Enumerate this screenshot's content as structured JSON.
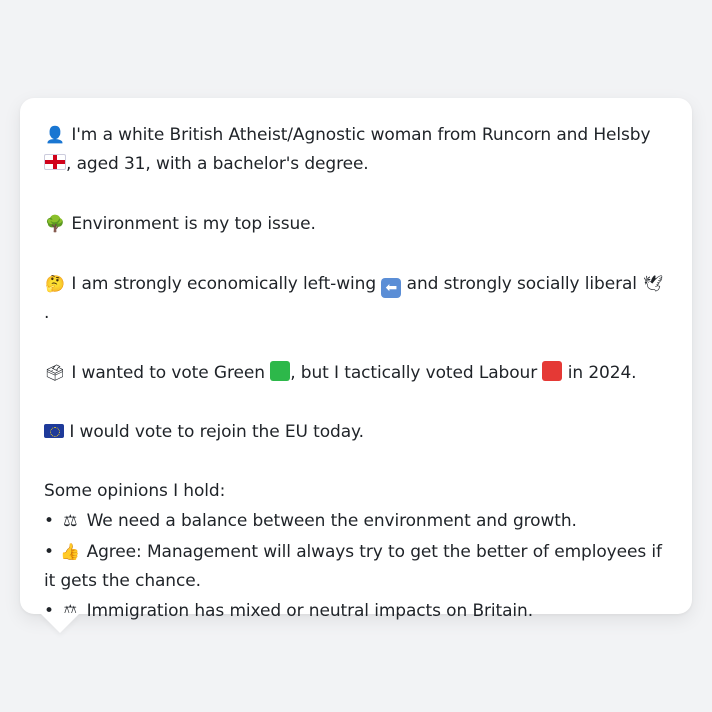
{
  "profile": {
    "intro_icon": "person-silhouette-icon",
    "intro_text_1": "I'm a white British Atheist/Agnostic woman from Runcorn and Helsby",
    "intro_flag": "england-flag-icon",
    "intro_text_2": ", aged 31, with a bachelor's degree.",
    "issue_icon": "tree-icon",
    "issue_text": "Environment is my top issue.",
    "ideology_icon": "thinking-face-icon",
    "ideology_text_1": "I am strongly economically left-wing",
    "ideology_arrow": "left-arrow-icon",
    "ideology_text_2": "and strongly socially liberal",
    "ideology_dove": "dove-icon",
    "ideology_text_3": ".",
    "vote_icon": "ballot-box-icon",
    "vote_text_1": "I wanted to vote Green",
    "vote_text_2": ", but I tactically voted Labour",
    "vote_text_3": "in 2024.",
    "vote_green_color": "#2db84a",
    "vote_red_color": "#e53935",
    "eu_icon": "eu-flag-icon",
    "eu_text": "I would vote to rejoin the EU today.",
    "opinions_heading": "Some opinions I hold:",
    "opinions": [
      {
        "bullet": "•",
        "icon": "scales-icon",
        "text": "We need a balance between the environment and growth."
      },
      {
        "bullet": "•",
        "icon": "thumbs-up-icon",
        "text": "Agree: Management will always try to get the better of employees if it gets the chance."
      },
      {
        "bullet": "•",
        "icon": "scales-icon",
        "text": "Immigration has mixed or neutral impacts on Britain."
      }
    ]
  }
}
